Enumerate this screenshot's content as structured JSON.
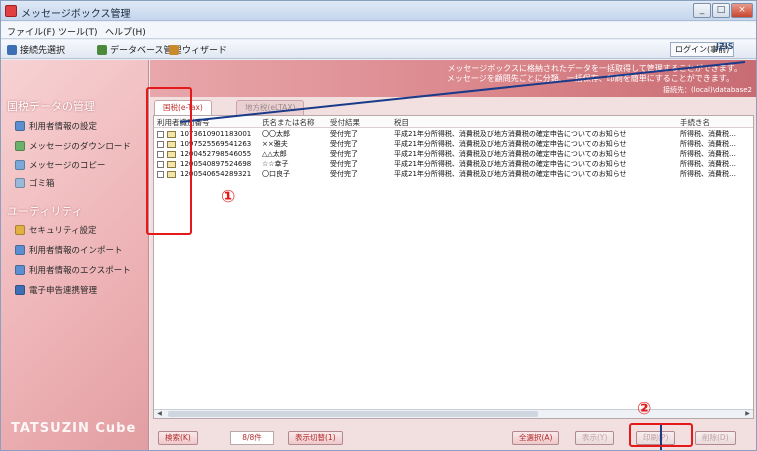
{
  "window": {
    "title": "メッセージボックス管理",
    "controls": [
      "_",
      "□",
      "×"
    ]
  },
  "menu": {
    "items": [
      "ファイル(F)",
      "ツール(T)",
      "ヘルプ(H)"
    ]
  },
  "toolbar": {
    "items": [
      "接続先選択",
      "データベース管理",
      "ウィザード"
    ],
    "login_label": "ログイン(事前)",
    "brand": "JZIS"
  },
  "sidebar": {
    "section1_title": "国税データの管理",
    "section1_items": [
      "利用者情報の設定",
      "メッセージのダウンロード",
      "メッセージのコピー",
      "ゴミ箱"
    ],
    "section2_title": "ユーティリティ",
    "section2_items": [
      "セキュリティ設定",
      "利用者情報のインポート",
      "利用者情報のエクスポート",
      "電子申告連携管理"
    ],
    "brand": "TATSUZIN Cube"
  },
  "banner": {
    "line1": "メッセージボックスに格納されたデータを一括取得して管理することができます。",
    "line2": "メッセージを顧問先ごとに分類、一括保存、印刷を簡単にすることができます。",
    "path": "接続先：(local)\\database2"
  },
  "tabs": {
    "active": "国税(e-Tax)",
    "inactive": "地方税(eLTAX)"
  },
  "table": {
    "columns": [
      "利用者識別番号",
      "氏名または名称",
      "受付結果",
      "税目",
      "手続き名"
    ],
    "rows": [
      {
        "id": "1073610901183001",
        "name": "〇〇太郎",
        "result": "受付完了",
        "subject": "平成21年分所得税、消費税及び地方消費税の確定申告についてのお知らせ",
        "proc": "所得税、消費税…"
      },
      {
        "id": "1097525569541263",
        "name": "××雅夫",
        "result": "受付完了",
        "subject": "平成21年分所得税、消費税及び地方消費税の確定申告についてのお知らせ",
        "proc": "所得税、消費税…"
      },
      {
        "id": "1200452798546055",
        "name": "△△太郎",
        "result": "受付完了",
        "subject": "平成21年分所得税、消費税及び地方消費税の確定申告についてのお知らせ",
        "proc": "所得税、消費税…"
      },
      {
        "id": "1200540897524698",
        "name": "☆☆幸子",
        "result": "受付完了",
        "subject": "平成21年分所得税、消費税及び地方消費税の確定申告についてのお知らせ",
        "proc": "所得税、消費税…"
      },
      {
        "id": "1200540654289321",
        "name": "〇口良子",
        "result": "受付完了",
        "subject": "平成21年分所得税、消費税及び地方消費税の確定申告についてのお知らせ",
        "proc": "所得税、消費税…"
      }
    ]
  },
  "buttons": {
    "search": "検索(K)",
    "counter": "8/8件",
    "toggle": "表示切替(1)",
    "select_all": "全選択(A)",
    "view": "表示(Y)",
    "print": "印刷(P)",
    "delete": "削除(D)"
  },
  "annotations": {
    "num1": "①",
    "num2": "②",
    "color": "#e51919"
  },
  "colors": {
    "sidebar": "#eeb5b8",
    "banner": "#d98489",
    "accent_text": "#b02a2a"
  }
}
